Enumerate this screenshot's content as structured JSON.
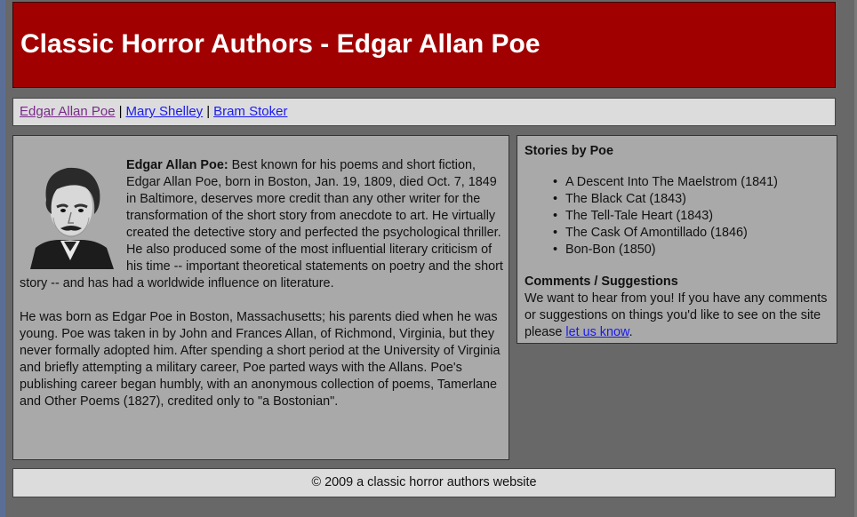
{
  "header": {
    "title": "Classic Horror Authors - Edgar Allan Poe"
  },
  "nav": {
    "links": [
      "Edgar Allan Poe",
      "Mary Shelley",
      "Bram Stoker"
    ],
    "separator": "|"
  },
  "main": {
    "intro_name": "Edgar Allan Poe:",
    "intro_text": " Best known for his poems and short fiction, Edgar Allan Poe, born in Boston, Jan. 19, 1809, died Oct. 7, 1849 in Baltimore, deserves more credit than any other writer for the transformation of the short story from anecdote to art. He virtually created the detective story and perfected the psychological thriller. He also produced some of the most influential literary criticism of his time -- important theoretical statements on poetry and the short story -- and has had a worldwide influence on literature.",
    "paragraph2": "He was born as Edgar Poe in Boston, Massachusetts; his parents died when he was young. Poe was taken in by John and Frances Allan, of Richmond, Virginia, but they never formally adopted him. After spending a short period at the University of Virginia and briefly attempting a military career, Poe parted ways with the Allans. Poe's publishing career began humbly, with an anonymous collection of poems, Tamerlane and Other Poems (1827), credited only to \"a Bostonian\"."
  },
  "sidebar": {
    "stories_heading": "Stories by Poe",
    "stories": [
      "A Descent Into The Maelstrom (1841)",
      "The Black Cat (1843)",
      "The Tell-Tale Heart (1843)",
      "The Cask Of Amontillado (1846)",
      "Bon-Bon (1850)"
    ],
    "comments_heading": "Comments / Suggestions",
    "comments_text": "We want to hear from you! If you have any comments or suggestions on things you'd like to see on the site please ",
    "comments_link": "let us know",
    "comments_end": "."
  },
  "footer": {
    "text": "© 2009 a classic horror authors website"
  },
  "colors": {
    "header_bg": "#a10000",
    "page_bg": "#686868",
    "panel_bg": "#a9a9a9",
    "bar_bg": "#dcdcdc",
    "link": "#1a1aee",
    "visited_link": "#7a2a8a"
  }
}
